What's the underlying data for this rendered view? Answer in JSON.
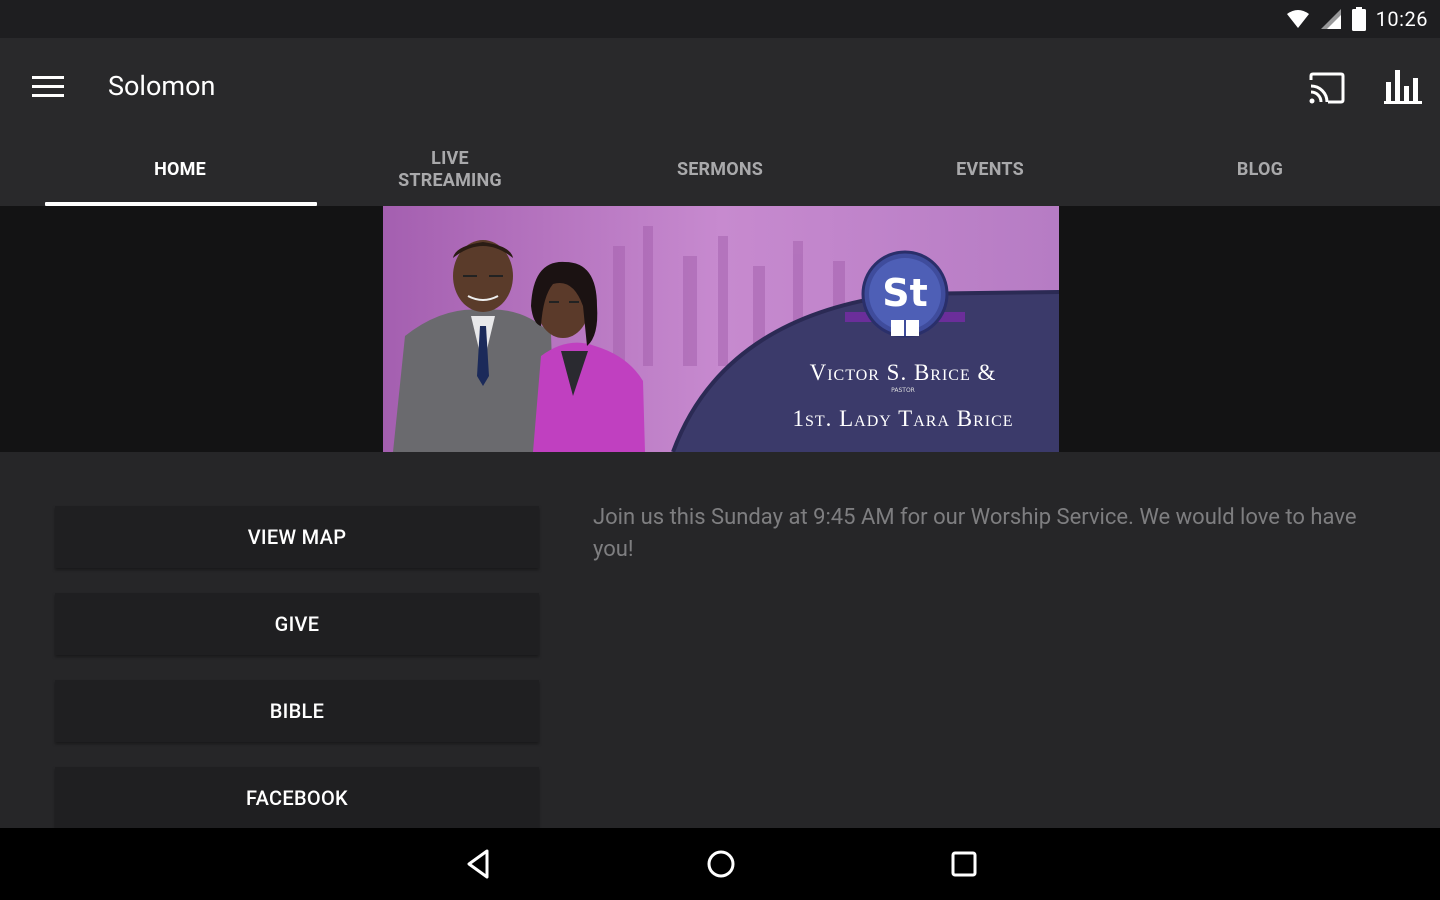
{
  "status_bar": {
    "time": "10:26",
    "icons": [
      "wifi-icon",
      "signal-icon",
      "battery-icon"
    ]
  },
  "app_bar": {
    "title": "Solomon",
    "icons": [
      "menu-icon",
      "cast-icon",
      "bar-chart-icon"
    ]
  },
  "tabs": [
    {
      "label": "HOME",
      "active": true
    },
    {
      "label": "LIVE STREAMING",
      "active": false
    },
    {
      "label": "SERMONS",
      "active": false
    },
    {
      "label": "EVENTS",
      "active": false
    },
    {
      "label": "BLOG",
      "active": false
    }
  ],
  "banner": {
    "logo_text": "St",
    "line1": "Victor S. Brice &",
    "sub": "PASTOR",
    "line2": "1st. Lady Tara Brice"
  },
  "actions": [
    {
      "label": "VIEW MAP"
    },
    {
      "label": "GIVE"
    },
    {
      "label": "BIBLE"
    },
    {
      "label": "FACEBOOK"
    }
  ],
  "message": "Join us this Sunday at 9:45 AM for our Worship Service. We would love to have you!",
  "nav_bar": [
    "back-icon",
    "home-icon",
    "recents-icon"
  ],
  "colors": {
    "app_bar": "#29292b",
    "background": "#262628",
    "banner_purple": "#3b3a6a",
    "banner_magenta": "#b36fc0"
  }
}
